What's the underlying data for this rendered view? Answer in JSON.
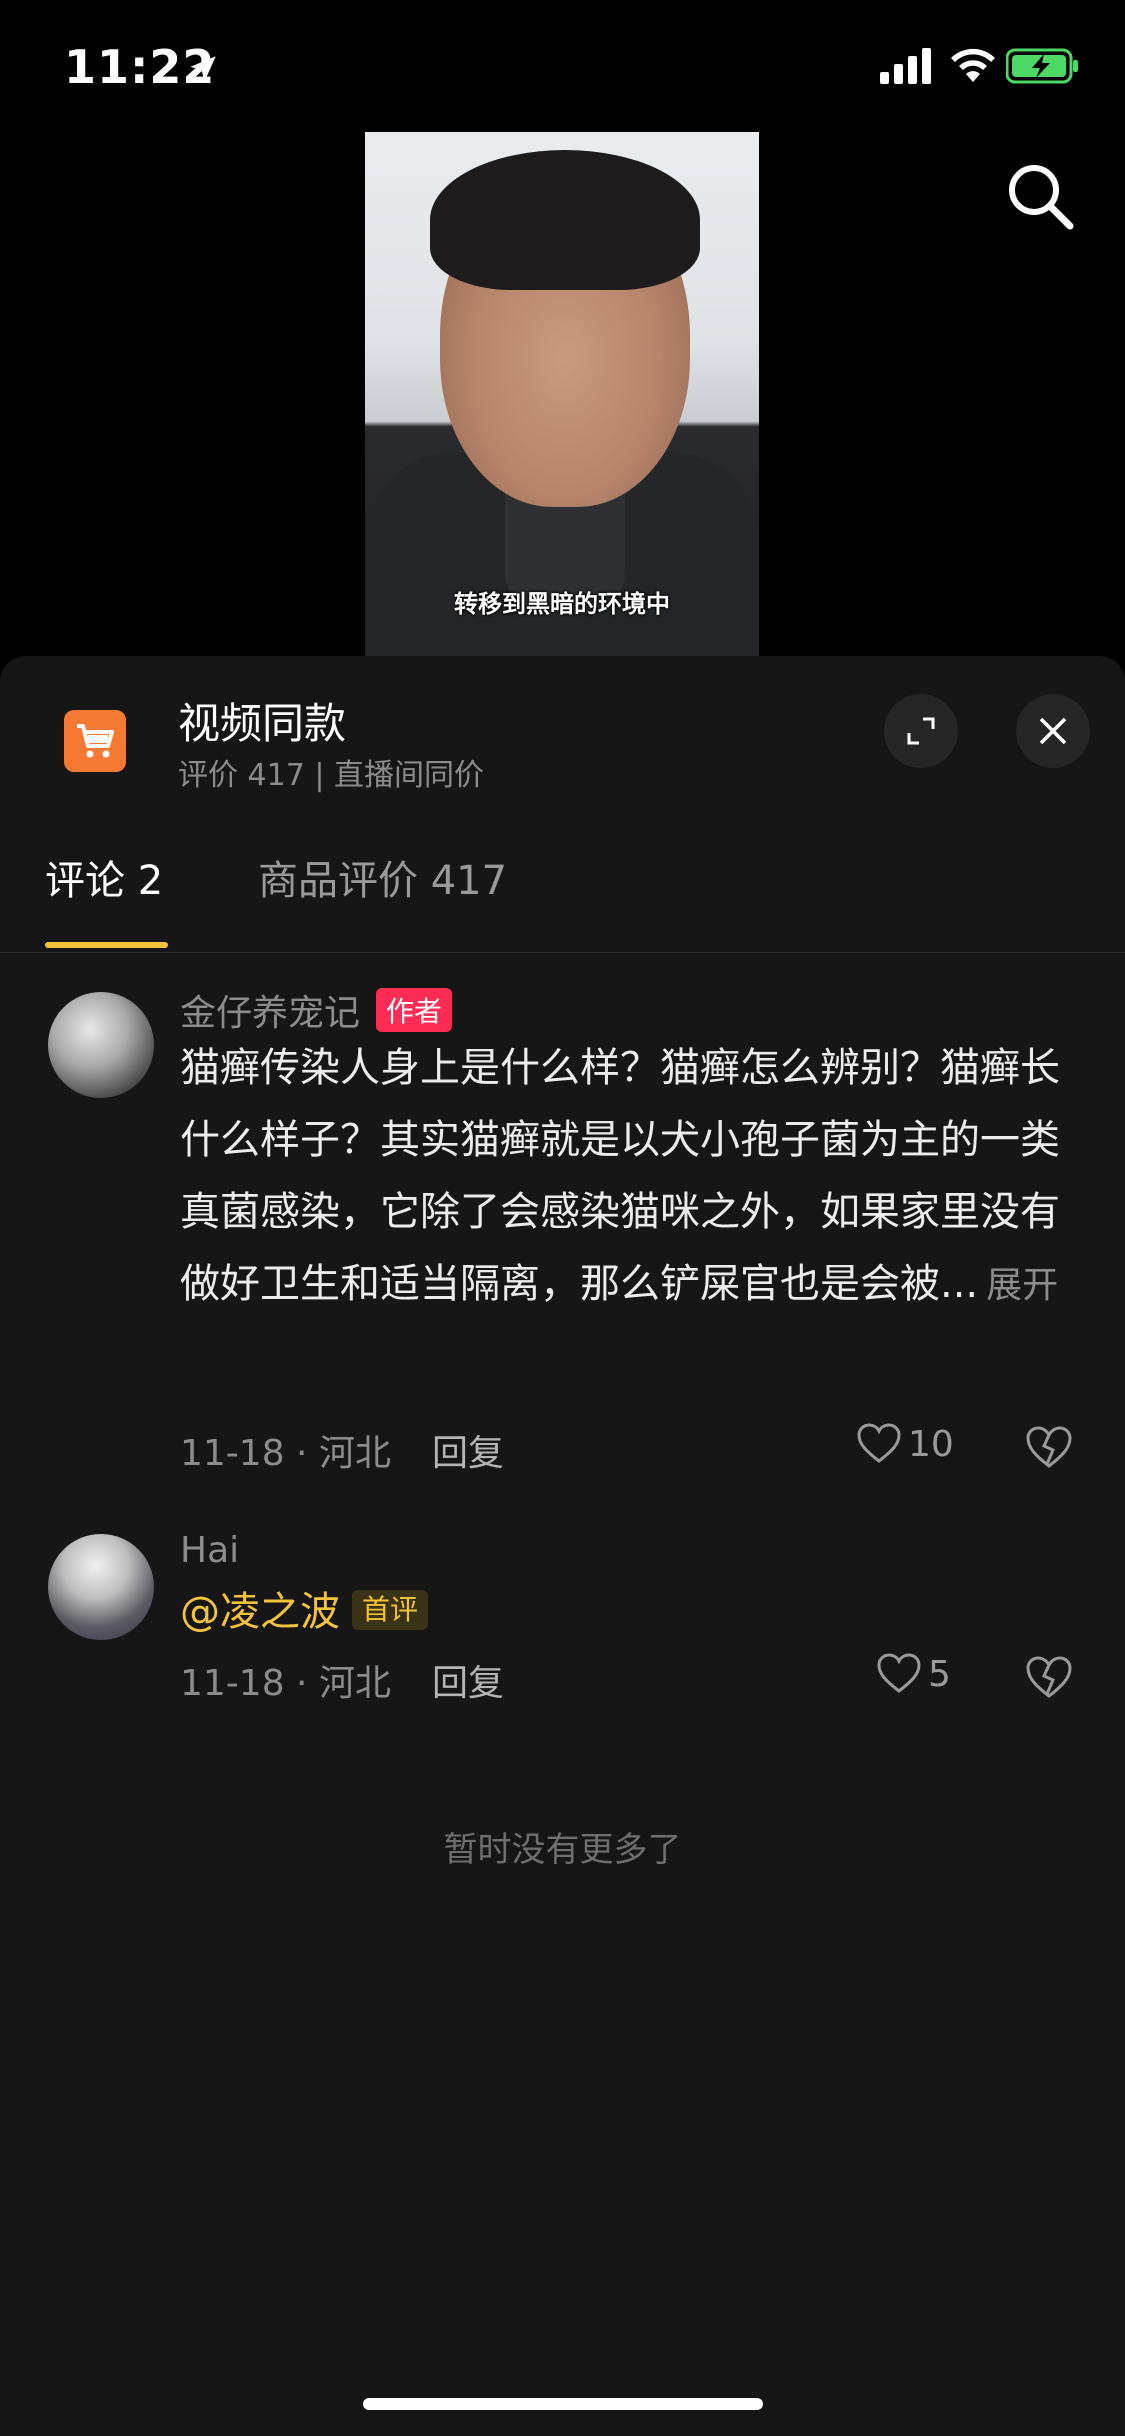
{
  "status_bar": {
    "time": "11:22"
  },
  "video": {
    "subtitle": "转移到黑暗的环境中"
  },
  "product": {
    "title": "视频同款",
    "subtitle": "评价 417 | 直播间同价"
  },
  "tabs": [
    {
      "label": "评论 2",
      "active": true
    },
    {
      "label": "商品评价 417",
      "active": false
    }
  ],
  "comments": [
    {
      "user": "金仔养宠记",
      "badge": "作者",
      "text": "猫癣传染人身上是什么样？猫癣怎么辨别？猫癣长什么样子？其实猫癣就是以犬小孢子菌为主的一类真菌感染，它除了会感染猫咪之外，如果家里没有做好卫生和适当隔离，那么铲屎官也是会被...",
      "expand": "展开",
      "meta": "11-18 · 河北",
      "reply": "回复",
      "likes": "10"
    },
    {
      "user": "Hai",
      "mention": "@凌之波",
      "badge": "首评",
      "meta": "11-18 · 河北",
      "reply": "回复",
      "likes": "5"
    }
  ],
  "footer": {
    "no_more": "暂时没有更多了"
  },
  "colors": {
    "accent": "#f5c339",
    "author_badge": "#fe2c55",
    "cart": "#f47a33",
    "battery": "#4cd964"
  }
}
